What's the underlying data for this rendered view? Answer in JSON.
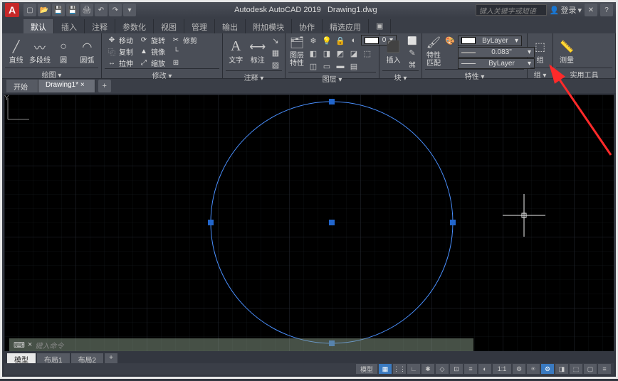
{
  "title": {
    "app": "Autodesk AutoCAD 2019",
    "file": "Drawing1.dwg",
    "search_placeholder": "键入关键字或短语",
    "login": "登录"
  },
  "qat": [
    "new",
    "open",
    "save",
    "saveas",
    "plot",
    "undo",
    "redo"
  ],
  "tabs": [
    "默认",
    "插入",
    "注释",
    "参数化",
    "视图",
    "管理",
    "输出",
    "附加模块",
    "协作",
    "精选应用"
  ],
  "tabs_active": 0,
  "draw_panel": {
    "title": "绘图 ▾",
    "big": [
      {
        "name": "line",
        "label": "直线",
        "glyph": "╱"
      },
      {
        "name": "polyline",
        "label": "多段线",
        "glyph": "⟋"
      },
      {
        "name": "circle",
        "label": "圆",
        "glyph": "○"
      },
      {
        "name": "arc",
        "label": "圆弧",
        "glyph": "◠"
      }
    ]
  },
  "modify_panel": {
    "title": "修改 ▾",
    "rows": [
      {
        "name": "move",
        "label": "移动",
        "glyph": "✥"
      },
      {
        "name": "rotate",
        "label": "旋转",
        "glyph": "⟳"
      },
      {
        "name": "trim",
        "label": "修剪",
        "glyph": "✂"
      },
      {
        "name": "copy",
        "label": "复制",
        "glyph": "⿻"
      },
      {
        "name": "mirror",
        "label": "镜像",
        "glyph": "▲"
      },
      {
        "name": "more1",
        "label": "",
        "glyph": "□"
      },
      {
        "name": "stretch",
        "label": "拉伸",
        "glyph": "↔"
      },
      {
        "name": "scale",
        "label": "缩放",
        "glyph": "⤢"
      },
      {
        "name": "array",
        "label": "",
        "glyph": "⊞"
      }
    ]
  },
  "annotate_panel": {
    "title": "注释 ▾",
    "big": [
      {
        "name": "text",
        "label": "文字",
        "glyph": "A"
      },
      {
        "name": "dim",
        "label": "标注",
        "glyph": "↔"
      }
    ]
  },
  "layer_panel": {
    "title": "图层 ▾",
    "big_label": "图层\n特性"
  },
  "block_panel": {
    "title": "块 ▾",
    "big_label": "插入"
  },
  "prop_panel": {
    "title": "特性 ▾",
    "big_label": "特性\n匹配",
    "color": "ByLayer",
    "lineweight": "0.083\"",
    "linetype": "ByLayer"
  },
  "group_panel": {
    "title": "组 ▾",
    "big_label": "组"
  },
  "util_panel": {
    "title": "实用工具",
    "big_label": "测量"
  },
  "filetabs": {
    "start": "开始",
    "drawing": "Drawing1*"
  },
  "cmd_prompt": "键入命令",
  "layout_tabs": [
    "模型",
    "布局1",
    "布局2"
  ],
  "status": {
    "model_btn": "模型",
    "scale": "1:1"
  },
  "ucs_label": "Y"
}
